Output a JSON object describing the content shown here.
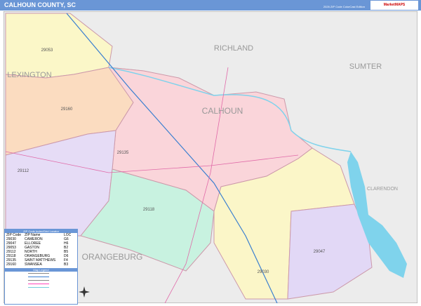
{
  "header": {
    "title": "CALHOUN COUNTY, SC",
    "subtitle": "2026 ZIP Code ColorCast Edition",
    "logo": "MarketMAPS"
  },
  "map": {
    "county_labels": [
      {
        "text": "RICHLAND"
      },
      {
        "text": "SUMTER"
      },
      {
        "text": "LEXINGTON"
      },
      {
        "text": "CALHOUN"
      },
      {
        "text": "CLARENDON"
      },
      {
        "text": "ORANGEBURG"
      }
    ],
    "zip_labels": [
      "29053",
      "29160",
      "29135",
      "29112",
      "29118",
      "29030",
      "29047"
    ],
    "colors": {
      "29053": "#fbf7c8",
      "29160": "#fbdcc0",
      "29135": "#fad5da",
      "29112": "#e6dcf6",
      "29118": "#c8f2e0",
      "29030": "#fbf6c8",
      "29047": "#e2d8f6",
      "water": "#7fd3ec",
      "background": "#ececec",
      "header": "#6a96d6"
    }
  },
  "legend": {
    "title": "ZIP Code Index/Grid Locator",
    "columns": [
      "ZIP Code",
      "ZIP Name",
      "LOC"
    ],
    "rows": [
      [
        "29030",
        "CAMERON",
        "G6"
      ],
      [
        "29047",
        "ELLOREE",
        "H6"
      ],
      [
        "29053",
        "GASTON",
        "B2"
      ],
      [
        "29112",
        "NORTH",
        "B5"
      ],
      [
        "29118",
        "ORANGEBURG",
        "D6"
      ],
      [
        "29135",
        "SAINT MATTHEWS",
        "F4"
      ],
      [
        "29160",
        "SWANSEA",
        "B3"
      ]
    ],
    "key_title": "Map Legend"
  }
}
